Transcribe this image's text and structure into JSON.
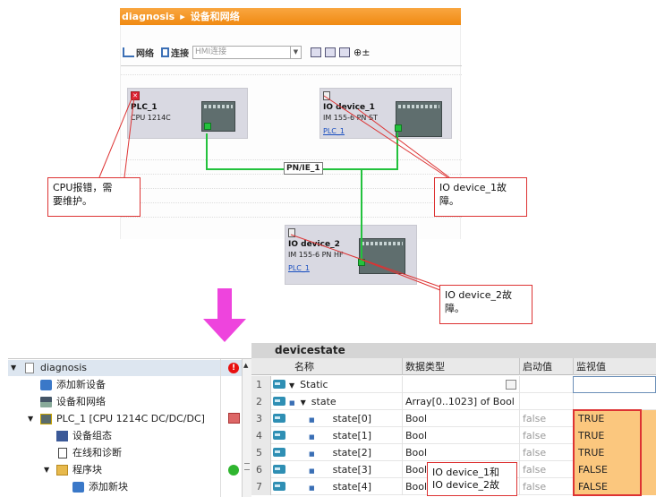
{
  "breadcrumb": {
    "project": "diagnosis",
    "separator": "▸",
    "view": "设备和网络"
  },
  "toolbar": {
    "network_label": "网络",
    "connections_label": "连接",
    "hmi_select_value": "HMI连接"
  },
  "network": {
    "subnet_label": "PN/IE_1",
    "devices": [
      {
        "name": "PLC_1",
        "type": "CPU 1214C",
        "link": ""
      },
      {
        "name": "IO device_1",
        "type": "IM 155-6 PN ST",
        "link": "PLC_1"
      },
      {
        "name": "IO device_2",
        "type": "IM 155-6 PN HF",
        "link": "PLC_1"
      }
    ]
  },
  "callouts": {
    "cpu_error_line1": "CPU报错，需",
    "cpu_error_line2": "要维护。",
    "io1_fault_line1": "IO device_1故",
    "io1_fault_line2": "障。",
    "io2_fault_line1": "IO device_2故",
    "io2_fault_line2": "障。",
    "table_note_line1": "IO device_1和",
    "table_note_line2": "IO device_2故"
  },
  "tree": {
    "items": [
      {
        "label": "diagnosis",
        "level": 0,
        "twisty": "▼",
        "icon": "project-icon",
        "status": "error-dot"
      },
      {
        "label": "添加新设备",
        "level": 1,
        "twisty": "",
        "icon": "add-device-icon",
        "status": ""
      },
      {
        "label": "设备和网络",
        "level": 1,
        "twisty": "",
        "icon": "network-icon",
        "status": ""
      },
      {
        "label": "PLC_1 [CPU 1214C DC/DC/DC]",
        "level": 1,
        "twisty": "▼",
        "icon": "plc-icon",
        "status": "error-square"
      },
      {
        "label": "设备组态",
        "level": 2,
        "twisty": "",
        "icon": "device-config-icon",
        "status": ""
      },
      {
        "label": "在线和诊断",
        "level": 2,
        "twisty": "",
        "icon": "online-diagnostics-icon",
        "status": ""
      },
      {
        "label": "程序块",
        "level": 2,
        "twisty": "▼",
        "icon": "folder-icon",
        "status": "ok-dot"
      },
      {
        "label": "添加新块",
        "level": 3,
        "twisty": "",
        "icon": "add-block-icon",
        "status": ""
      }
    ],
    "error_glyph": "!"
  },
  "db": {
    "title": "devicestate",
    "columns": {
      "name": "名称",
      "type": "数据类型",
      "start": "启动值",
      "monitor": "监视值"
    },
    "rows": [
      {
        "num": "1",
        "twisty": "▼",
        "bullet": "",
        "name": "Static",
        "type": "",
        "start": "",
        "monitor": "",
        "indent": 0
      },
      {
        "num": "2",
        "twisty": "▼",
        "bullet": "■",
        "name": "state",
        "type": "Array[0..1023] of Bool",
        "start": "",
        "monitor": "",
        "indent": 1
      },
      {
        "num": "3",
        "twisty": "",
        "bullet": "■",
        "name": "state[0]",
        "type": "Bool",
        "start": "false",
        "monitor": "TRUE",
        "indent": 2
      },
      {
        "num": "4",
        "twisty": "",
        "bullet": "■",
        "name": "state[1]",
        "type": "Bool",
        "start": "false",
        "monitor": "TRUE",
        "indent": 2
      },
      {
        "num": "5",
        "twisty": "",
        "bullet": "■",
        "name": "state[2]",
        "type": "Bool",
        "start": "false",
        "monitor": "TRUE",
        "indent": 2
      },
      {
        "num": "6",
        "twisty": "",
        "bullet": "■",
        "name": "state[3]",
        "type": "Bool",
        "start": "false",
        "monitor": "FALSE",
        "indent": 2
      },
      {
        "num": "7",
        "twisty": "",
        "bullet": "■",
        "name": "state[4]",
        "type": "Bool",
        "start": "false",
        "monitor": "FALSE",
        "indent": 2
      }
    ]
  },
  "colors": {
    "title_bar": "#f08a12",
    "subnet_line": "#23c23d",
    "callout_border": "#dd3333",
    "arrow": "#ee44dd",
    "monitor_highlight": "#fbc77e"
  }
}
